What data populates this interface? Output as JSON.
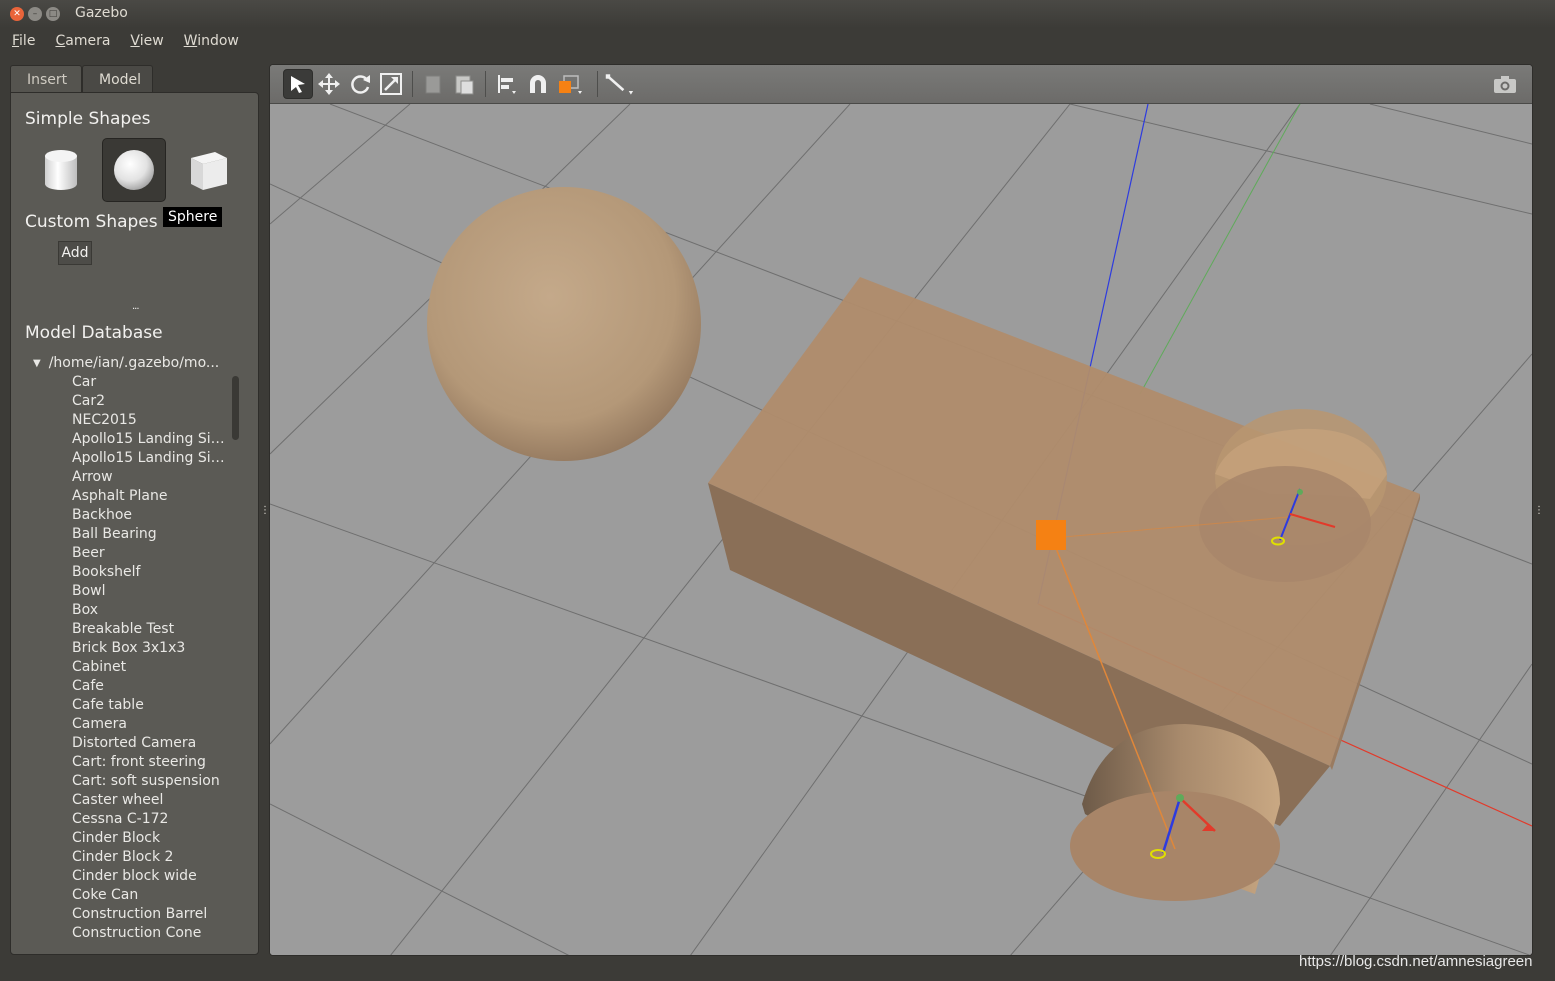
{
  "window": {
    "title": "Gazebo"
  },
  "menu": {
    "file": "File",
    "camera": "Camera",
    "view": "View",
    "window": "Window"
  },
  "tabs": {
    "insert": "Insert",
    "model": "Model"
  },
  "insert_panel": {
    "simple_shapes_title": "Simple Shapes",
    "shapes": [
      {
        "name": "cylinder",
        "icon": "cylinder-icon"
      },
      {
        "name": "sphere",
        "icon": "sphere-icon",
        "selected": true
      },
      {
        "name": "box",
        "icon": "box-icon"
      }
    ],
    "tooltip": "Sphere",
    "custom_shapes_title": "Custom Shapes",
    "add_label": "Add",
    "splitter_dots": "...",
    "model_database_title": "Model Database",
    "tree_root": "/home/ian/.gazebo/mo...",
    "models": [
      "Car",
      "Car2",
      "NEC2015",
      "Apollo15 Landing Sit...",
      "Apollo15 Landing Sit...",
      "Arrow",
      "Asphalt Plane",
      "Backhoe",
      "Ball Bearing",
      "Beer",
      "Bookshelf",
      "Bowl",
      "Box",
      "Breakable Test",
      "Brick Box 3x1x3",
      "Cabinet",
      "Cafe",
      "Cafe table",
      "Camera",
      "Distorted Camera",
      "Cart: front steering",
      "Cart: soft suspension",
      "Caster wheel",
      "Cessna C-172",
      "Cinder Block",
      "Cinder Block 2",
      "Cinder block wide",
      "Coke Can",
      "Construction Barrel",
      "Construction Cone"
    ]
  },
  "toolbar": {
    "icons": [
      "select-arrow-icon",
      "translate-icon",
      "rotate-icon",
      "scale-icon",
      "copy-icon",
      "paste-icon",
      "align-icon",
      "snap-magnet-icon",
      "view-angle-icon",
      "joint-icon",
      "screenshot-camera-icon"
    ]
  },
  "colors": {
    "accent_orange": "#f58113",
    "model_tan": "#c7a47e",
    "axis_x": "#e23a2a",
    "axis_y": "#4caf50",
    "axis_z": "#2d3bdf"
  },
  "watermark": "https://blog.csdn.net/amnesiagreen"
}
